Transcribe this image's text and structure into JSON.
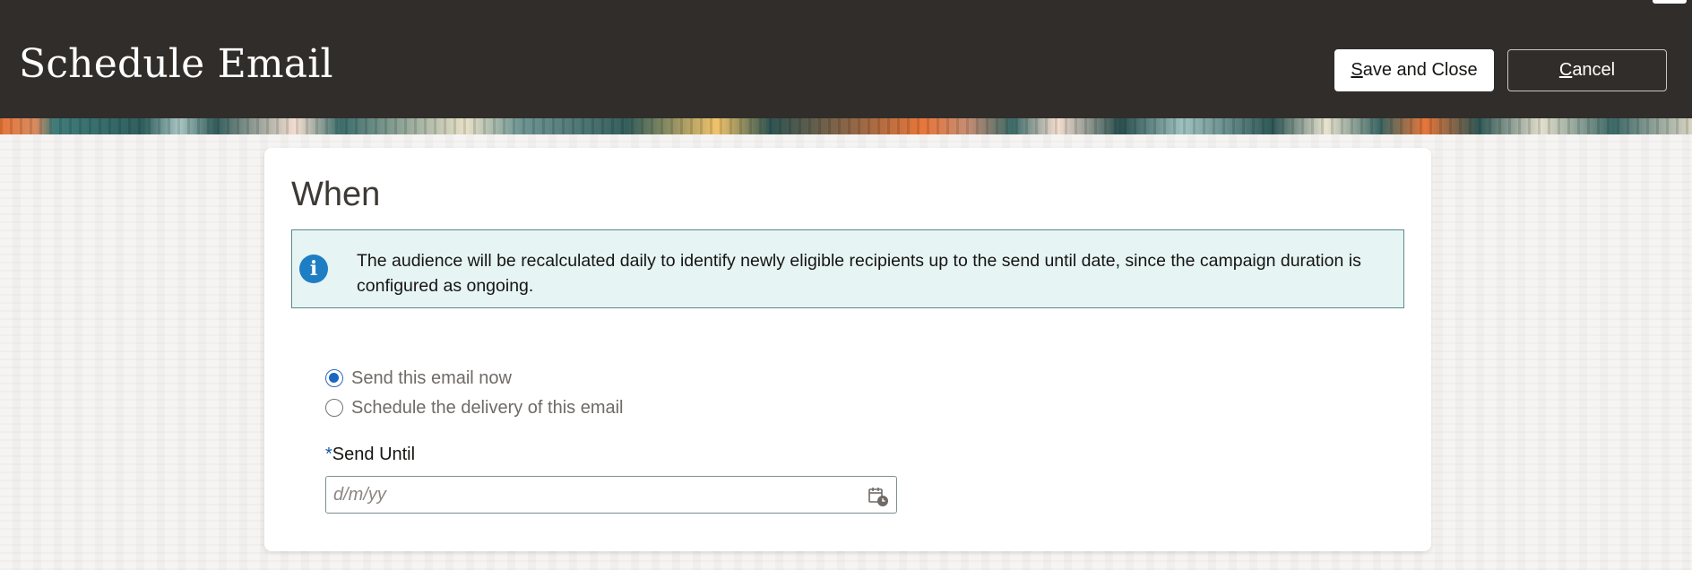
{
  "header": {
    "title": "Schedule Email",
    "save_close": {
      "access_key": "S",
      "rest": "ave and Close"
    },
    "cancel": {
      "access_key": "C",
      "rest": "ancel"
    }
  },
  "section": {
    "title": "When",
    "info_icon": "info-icon",
    "info_message": "The audience will be recalculated daily to identify newly eligible recipients up to the send until date, since the campaign duration is configured as ongoing."
  },
  "delivery": {
    "options": [
      {
        "label": "Send this email now",
        "selected": true
      },
      {
        "label": "Schedule the delivery of this email",
        "selected": false
      }
    ]
  },
  "send_until": {
    "required_marker": "*",
    "label": "Send Until",
    "value": "",
    "placeholder": "d/m/yy",
    "icon": "calendar-clock-icon"
  },
  "colors": {
    "header_bg": "#312d2a",
    "info_bg": "#e6f4f4",
    "info_icon": "#1e7ec4",
    "radio_selected": "#1a66c2",
    "required_marker": "#0f5ba6"
  }
}
